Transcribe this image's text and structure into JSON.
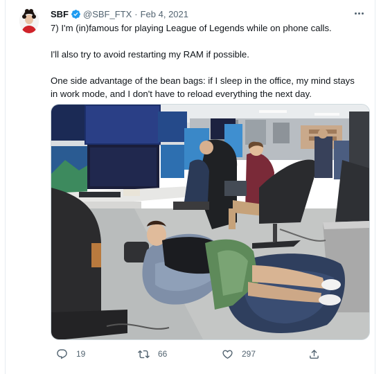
{
  "tweet": {
    "display_name": "SBF",
    "handle": "@SBF_FTX",
    "separator": "·",
    "date": "Feb 4, 2021",
    "paragraphs": [
      "7) I'm (in)famous for playing League of Legends while on phone calls.",
      "I'll also try to avoid restarting my RAM if possible.",
      "One side advantage of the bean bags: if I sleep in the office, my mind stays\nin work mode, and I don't have to reload everything the next day."
    ],
    "icons": {
      "verified": "verified-badge-icon",
      "more": "more-options-icon",
      "reply": "reply-icon",
      "retweet": "retweet-icon",
      "like": "like-heart-icon",
      "share": "share-icon"
    },
    "counts": {
      "replies": "19",
      "retweets": "66",
      "likes": "297"
    },
    "colors": {
      "verified_blue": "#1d9bf0",
      "secondary_text": "#536471",
      "primary_text": "#0f1419"
    }
  }
}
